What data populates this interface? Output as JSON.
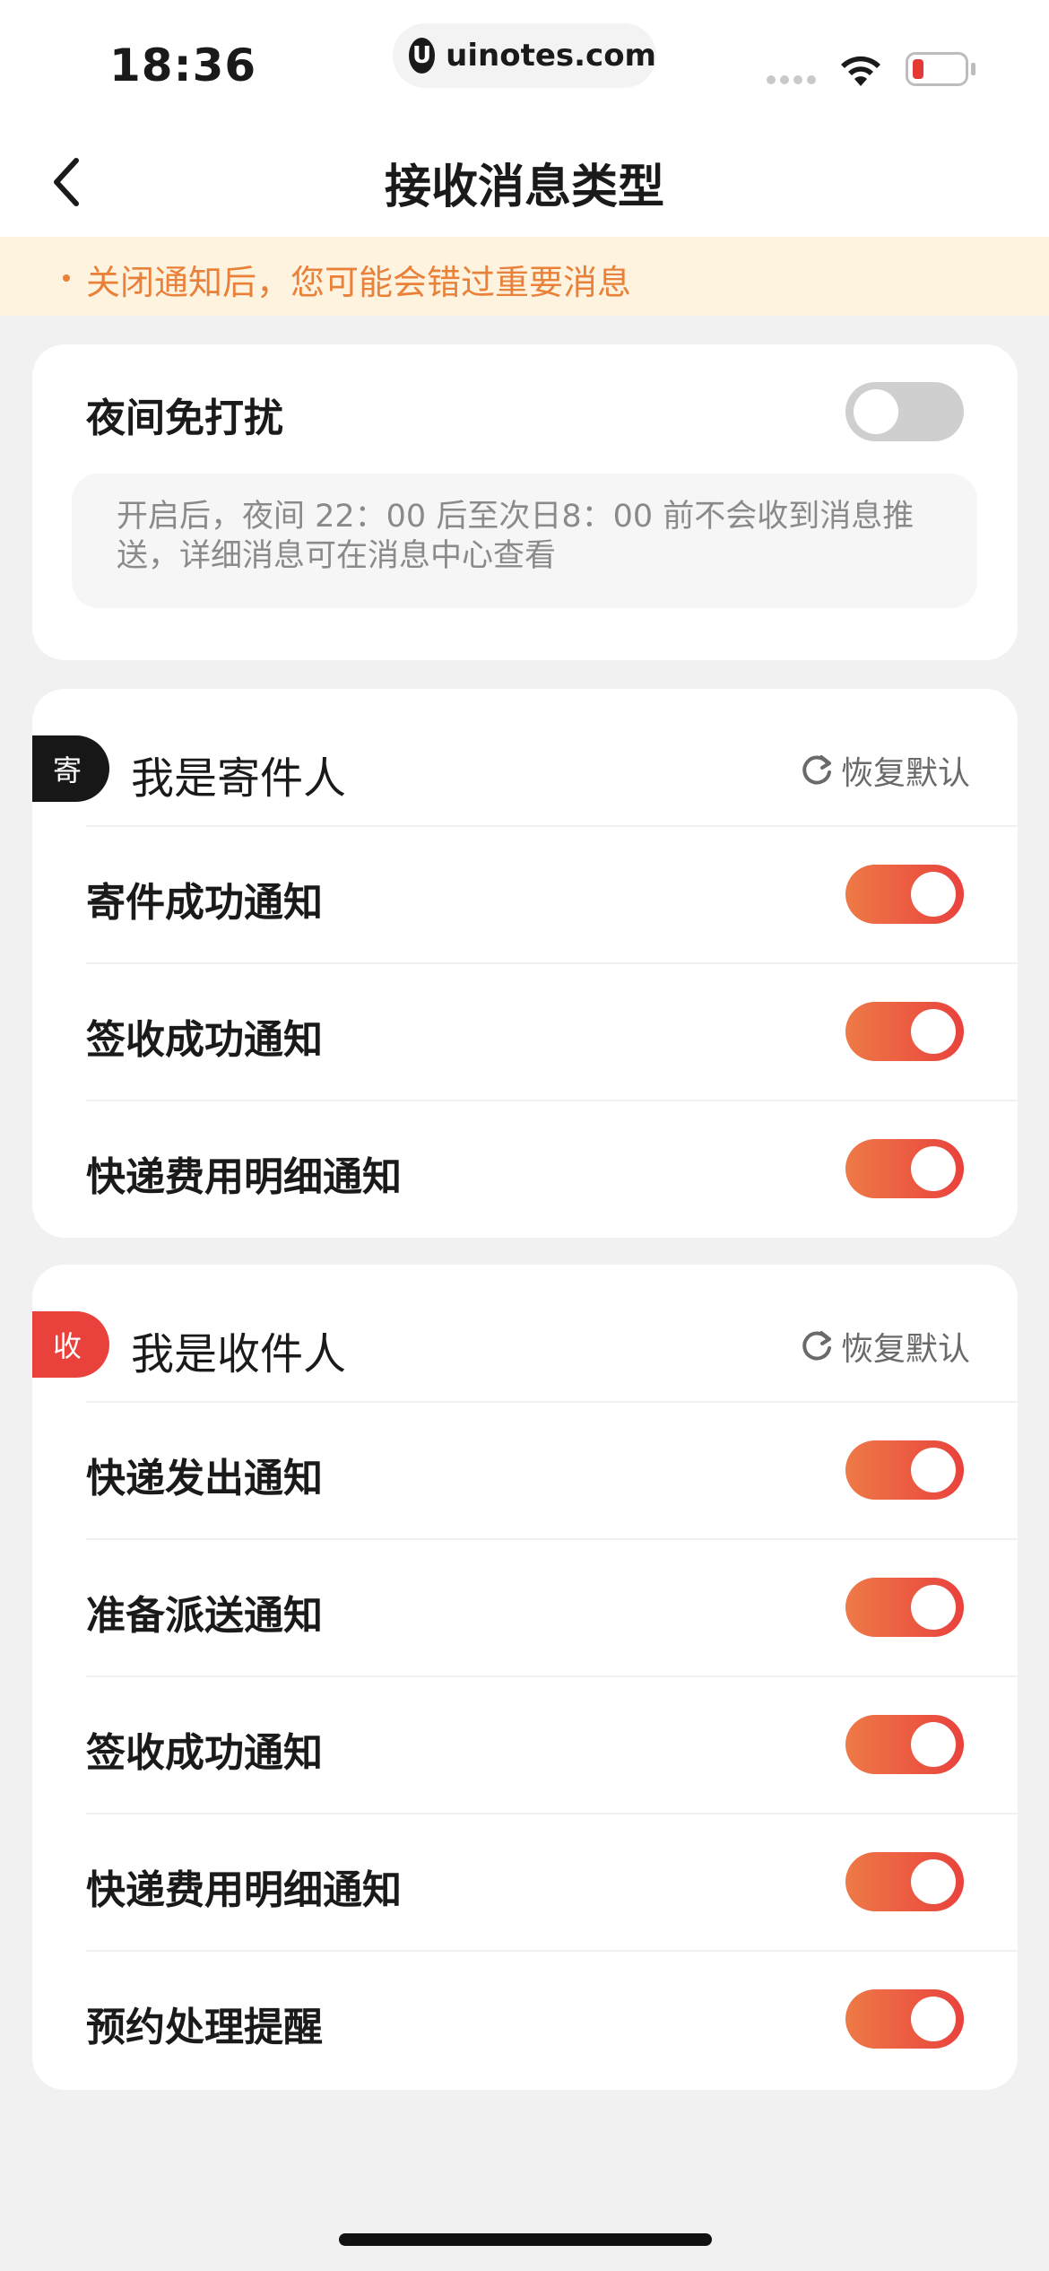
{
  "status_bar": {
    "time": "18:36",
    "site": "uinotes.com",
    "site_logo": "U"
  },
  "nav": {
    "title": "接收消息类型",
    "back_icon": "chevron-left-icon"
  },
  "banner": {
    "text": "关闭通知后，您可能会错过重要消息",
    "color": "#e9813a"
  },
  "night_mode": {
    "label": "夜间免打扰",
    "enabled": false,
    "description": "开启后，夜间 22：00 后至次日8：00 前不会收到消息推送，详细消息可在消息中心查看"
  },
  "sender": {
    "tag": "寄",
    "title": "我是寄件人",
    "reset_label": "恢复默认",
    "items": [
      {
        "label": "寄件成功通知",
        "enabled": true
      },
      {
        "label": "签收成功通知",
        "enabled": true
      },
      {
        "label": "快递费用明细通知",
        "enabled": true
      }
    ]
  },
  "receiver": {
    "tag": "收",
    "title": "我是收件人",
    "reset_label": "恢复默认",
    "items": [
      {
        "label": "快递发出通知",
        "enabled": true
      },
      {
        "label": "准备派送通知",
        "enabled": true
      },
      {
        "label": "签收成功通知",
        "enabled": true
      },
      {
        "label": "快递费用明细通知",
        "enabled": true
      },
      {
        "label": "预约处理提醒",
        "enabled": true
      }
    ]
  },
  "colors": {
    "accent_start": "#ee7a47",
    "accent_end": "#e9423d",
    "toggle_off": "#cfcfcf"
  }
}
